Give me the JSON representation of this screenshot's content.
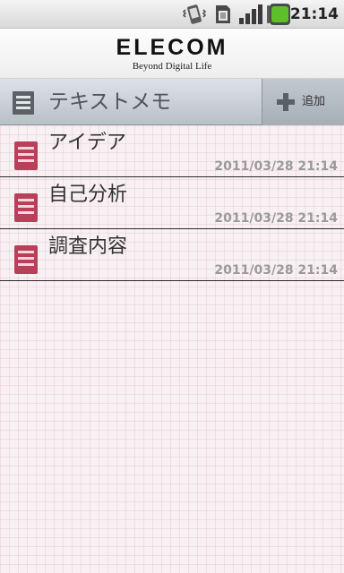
{
  "status_bar": {
    "time": "21:14",
    "icons": [
      "vibrate-icon",
      "sim-card-icon",
      "signal-icon",
      "battery-icon"
    ],
    "battery_color": "#5dc02a"
  },
  "header": {
    "logo_text": "ELECOM",
    "tagline": "Beyond Digital Life"
  },
  "title_bar": {
    "icon": "notepad-icon",
    "title": "テキストメモ",
    "add_button_label": "追加",
    "add_button_icon": "plus-icon"
  },
  "memos": [
    {
      "title": "アイデア",
      "date": "2011/03/28 21:14",
      "icon": "memo-icon"
    },
    {
      "title": "自己分析",
      "date": "2011/03/28 21:14",
      "icon": "memo-icon"
    },
    {
      "title": "調査内容",
      "date": "2011/03/28 21:14",
      "icon": "memo-icon"
    }
  ],
  "colors": {
    "memo_icon": "#b8405a",
    "titlebar_text": "#4e555c",
    "date_text": "#9a9a9a"
  }
}
